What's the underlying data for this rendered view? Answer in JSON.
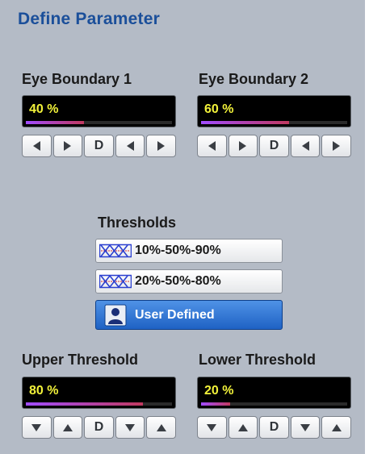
{
  "title": "Define Parameter",
  "eye_boundary_1": {
    "label": "Eye Boundary 1",
    "value": "40 %",
    "level": 0.4,
    "buttons": [
      "◀",
      "▶",
      "D",
      "◀",
      "▶"
    ]
  },
  "eye_boundary_2": {
    "label": "Eye Boundary 2",
    "value": "60 %",
    "level": 0.6,
    "buttons": [
      "◀",
      "▶",
      "D",
      "◀",
      "▶"
    ]
  },
  "thresholds": {
    "label": "Thresholds",
    "options": [
      {
        "label": "10%-50%-90%",
        "icon": "xx-waveform-icon",
        "selected": false
      },
      {
        "label": "20%-50%-80%",
        "icon": "xx-waveform-icon",
        "selected": false
      },
      {
        "label": "User Defined",
        "icon": "user-icon",
        "selected": true
      }
    ]
  },
  "upper_threshold": {
    "label": "Upper Threshold",
    "value": "80 %",
    "level": 0.8,
    "buttons": [
      "▼",
      "▲",
      "D",
      "▼",
      "▲"
    ]
  },
  "lower_threshold": {
    "label": "Lower Threshold",
    "value": "20 %",
    "level": 0.2,
    "buttons": [
      "▼",
      "▲",
      "D",
      "▼",
      "▲"
    ]
  },
  "colors": {
    "title": "#1b4f9a",
    "value_text": "#f2f23a",
    "panel_bg": "#b4bbc6",
    "selected_bg": "#2b6fd0"
  }
}
